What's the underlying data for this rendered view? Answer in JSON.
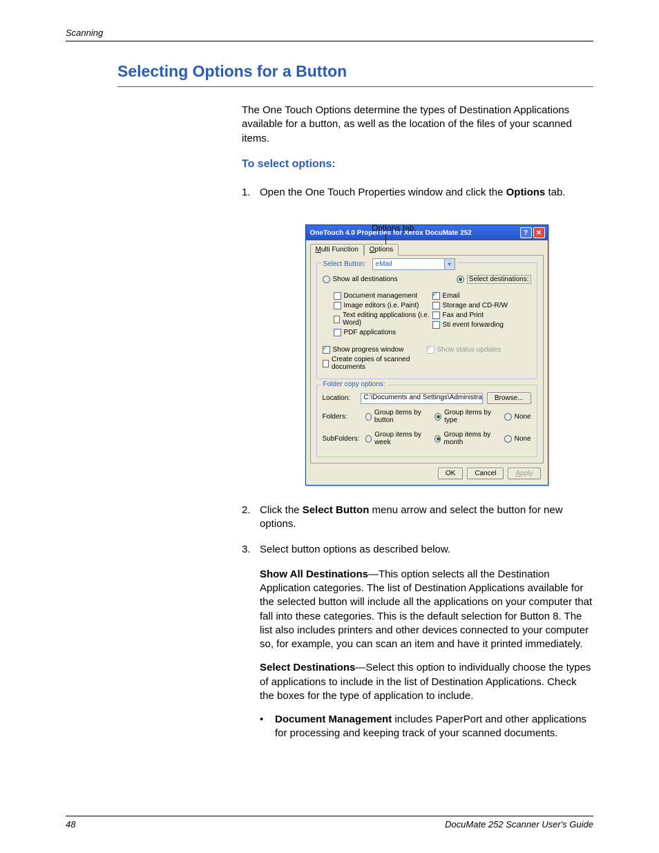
{
  "running_head": "Scanning",
  "h1": "Selecting Options for a Button",
  "intro": "The One Touch Options determine the types of Destination Applications available for a button, as well as the location of the files of your scanned items.",
  "h2": "To select options:",
  "step1_pre": "Open the One Touch Properties window and click the ",
  "step1_bold": "Options",
  "step1_post": " tab.",
  "callout": "Options tab.",
  "dialog": {
    "title": "OneTouch 4.0 Properties for Xerox DocuMate 252",
    "tab1_u": "M",
    "tab1_rest": "ulti Function",
    "tab2_u": "O",
    "tab2_rest": "ptions",
    "select_button_legend": "Select Button:",
    "select_value": "eMail",
    "show_all": "Show all destinations",
    "select_dest": "Select destinations:",
    "left_opts": [
      "Document management",
      "Image editors (i.e. Paint)",
      "Text editing applications (i.e. Word)",
      "PDF applications"
    ],
    "right_opts": [
      "Email",
      "Storage and CD-R/W",
      "Fax and Print",
      "Sti event forwarding"
    ],
    "show_progress": "Show progress window",
    "show_status": "Show status updates",
    "create_copies": "Create copies of scanned documents",
    "folder_legend": "Folder copy options:",
    "location_lbl": "Location:",
    "location_val": "C:\\Documents and Settings\\Administrator\\My Docum",
    "browse": "Browse...",
    "folders_lbl": "Folders:",
    "folders_opts": [
      "Group items by button",
      "Group items by type",
      "None"
    ],
    "subfolders_lbl": "SubFolders:",
    "subfolders_opts": [
      "Group items by week",
      "Group items by month",
      "None"
    ],
    "ok": "OK",
    "cancel": "Cancel",
    "apply_u": "A",
    "apply_rest": "pply"
  },
  "step2_pre": "Click the ",
  "step2_bold": "Select Button",
  "step2_post": " menu arrow and select the button for new options.",
  "step3": "Select button options as described below.",
  "p_show_all_bold": "Show All Destinations",
  "p_show_all_rest": "—This option selects all the Destination Application categories. The list of Destination Applications available for the selected button will include all the applications on your computer that fall into these categories. This is the default selection for Button 8. The list also includes printers and other devices connected to your computer so, for example, you can scan an item and have it printed immediately.",
  "p_select_dest_bold": "Select Destinations",
  "p_select_dest_rest": "—Select this option to individually choose the types of applications to include in the list of Destination Applications. Check the boxes for the type of application to include.",
  "bullet_docmgmt_bold": "Document Management",
  "bullet_docmgmt_rest": " includes PaperPort and other applications for processing and keeping track of your scanned documents.",
  "footer_page": "48",
  "footer_guide": "DocuMate 252 Scanner User's Guide"
}
